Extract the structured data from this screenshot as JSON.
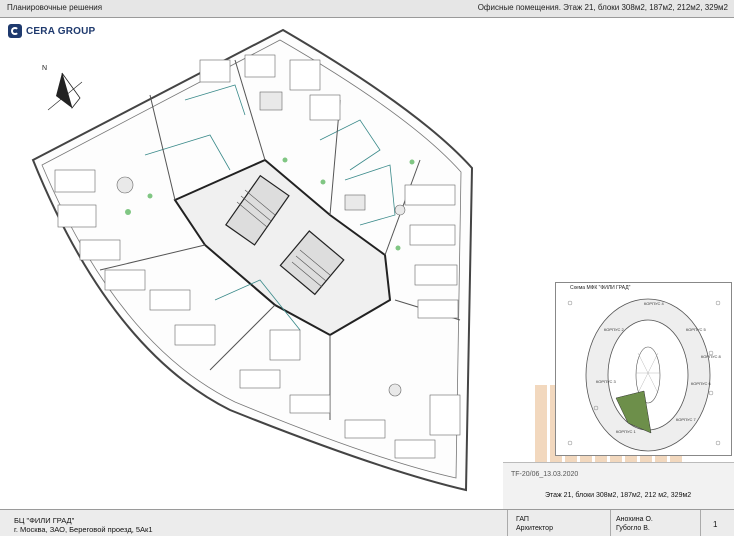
{
  "header": {
    "section_title": "Планировочные решения",
    "sheet_title": "Офисные помещения. Этаж 21, блоки 308м2, 187м2, 212м2, 329м2"
  },
  "logo": {
    "text": "CERA GROUP",
    "icon": "cera-group-logo-icon"
  },
  "compass": {
    "label": "N",
    "icon": "north-arrow-icon"
  },
  "inset": {
    "title": "Схема МФК \"ФИЛИ ГРАД\"",
    "labels": [
      "КОРПУС 4",
      "КОРПУС 5",
      "КОРПУС 6",
      "КОРПУС 7",
      "КОРПУС 3",
      "КОРПУС 2",
      "КОРПУС 1",
      "КОРПУС 8"
    ]
  },
  "sheet_meta": {
    "code": "TF-20/06_13.03.2020",
    "description": "Этаж 21, блоки 308м2, 187м2, 212 м2, 329м2"
  },
  "footer": {
    "project": "БЦ \"ФИЛИ ГРАД\"",
    "address": "г. Москва, ЗАО, Береговой проезд, 5Ак1",
    "role1": "ГАП",
    "role2": "Архитектор",
    "name1": "Анохина О.",
    "name2": "Губогло В.",
    "page": "1"
  },
  "colors": {
    "accent": "#1f3a6e",
    "watermark": "#e8b98a",
    "wall": "#333333",
    "partition": "#3a8a8a",
    "greenery": "#4caf50"
  }
}
